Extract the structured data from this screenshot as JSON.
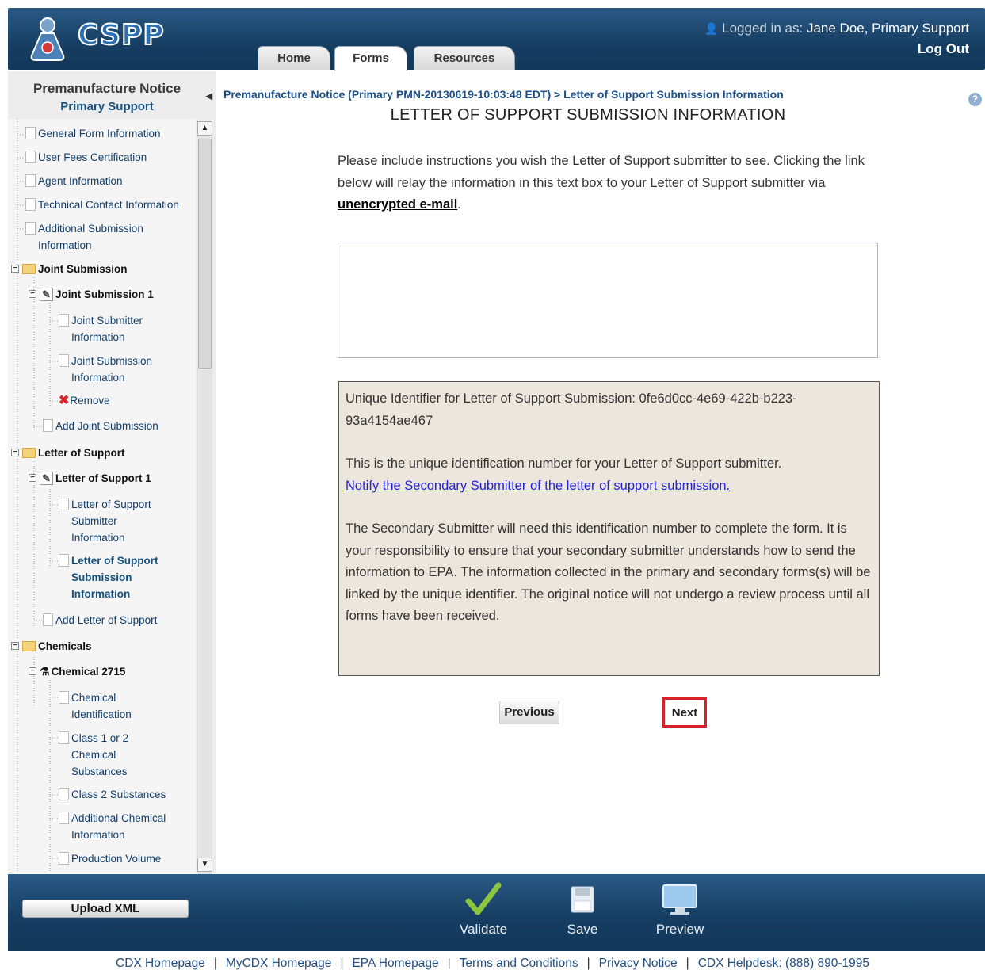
{
  "header": {
    "logo_text": "CSPP",
    "logged_prefix": "Logged in as:",
    "logged_user": "Jane Doe, Primary Support",
    "logout": "Log Out"
  },
  "tabs": [
    {
      "label": "Home"
    },
    {
      "label": "Forms",
      "active": true
    },
    {
      "label": "Resources"
    }
  ],
  "sidebar": {
    "title": "Premanufacture Notice",
    "subtitle": "Primary Support",
    "items": [
      {
        "label": "General Form Information"
      },
      {
        "label": "User Fees Certification"
      },
      {
        "label": "Agent Information"
      },
      {
        "label": "Technical Contact Information"
      },
      {
        "label": "Additional Submission Information"
      },
      {
        "label": "Joint Submission"
      },
      {
        "label": "Joint Submission 1"
      },
      {
        "label": "Joint Submitter Information"
      },
      {
        "label": "Joint Submission Information"
      },
      {
        "label": "Remove"
      },
      {
        "label": "Add Joint Submission"
      },
      {
        "label": "Letter of Support"
      },
      {
        "label": "Letter of Support 1"
      },
      {
        "label": "Letter of Support Submitter Information"
      },
      {
        "label": "Letter of Support Submission Information"
      },
      {
        "label": "Add Letter of Support"
      },
      {
        "label": "Chemicals"
      },
      {
        "label": "Chemical 2715"
      },
      {
        "label": "Chemical Identification"
      },
      {
        "label": "Class 1 or 2 Chemical Substances"
      },
      {
        "label": "Class 2 Substances"
      },
      {
        "label": "Additional Chemical Information"
      },
      {
        "label": "Production Volume"
      }
    ]
  },
  "main": {
    "breadcrumb": "Premanufacture Notice (Primary PMN-20130619-10:03:48 EDT) > Letter of Support Submission Information",
    "title": "LETTER OF SUPPORT SUBMISSION INFORMATION",
    "instructions_text": "Please include instructions you wish the Letter of Support submitter to see. Clicking the link below will relay the information in this text box to your Letter of Support submitter via",
    "instructions_link": "unencrypted e-mail",
    "instructions_end": ".",
    "textbox_value": "",
    "info_identifier": "Unique Identifier for Letter of Support Submission: 0fe6d0cc-4e69-422b-b223-93a4154ae467",
    "info_unique_text": "This is the unique identification number for your Letter of Support submitter.",
    "info_notify_link": "Notify the Secondary Submitter of the letter of support submission.",
    "info_paragraph": "The Secondary Submitter will need this identification number to complete the form. It is your responsibility to ensure that your secondary submitter understands how to send the information to EPA. The information collected in the primary and secondary forms(s) will be linked by the unique identifier. The original notice will not undergo a review process until all forms have been received.",
    "previous_label": "Previous",
    "next_label": "Next"
  },
  "footer_bar": {
    "upload": "Upload XML",
    "validate": "Validate",
    "save": "Save",
    "preview": "Preview"
  },
  "bottom_links": [
    "CDX Homepage",
    "MyCDX Homepage",
    "EPA Homepage",
    "Terms and Conditions",
    "Privacy Notice",
    "CDX Helpdesk: (888) 890-1995"
  ],
  "colors": {
    "header_blue": "#163e62",
    "link_blue": "#2323d6",
    "info_bg": "#ede6dd",
    "next_highlight": "#d9212a"
  }
}
